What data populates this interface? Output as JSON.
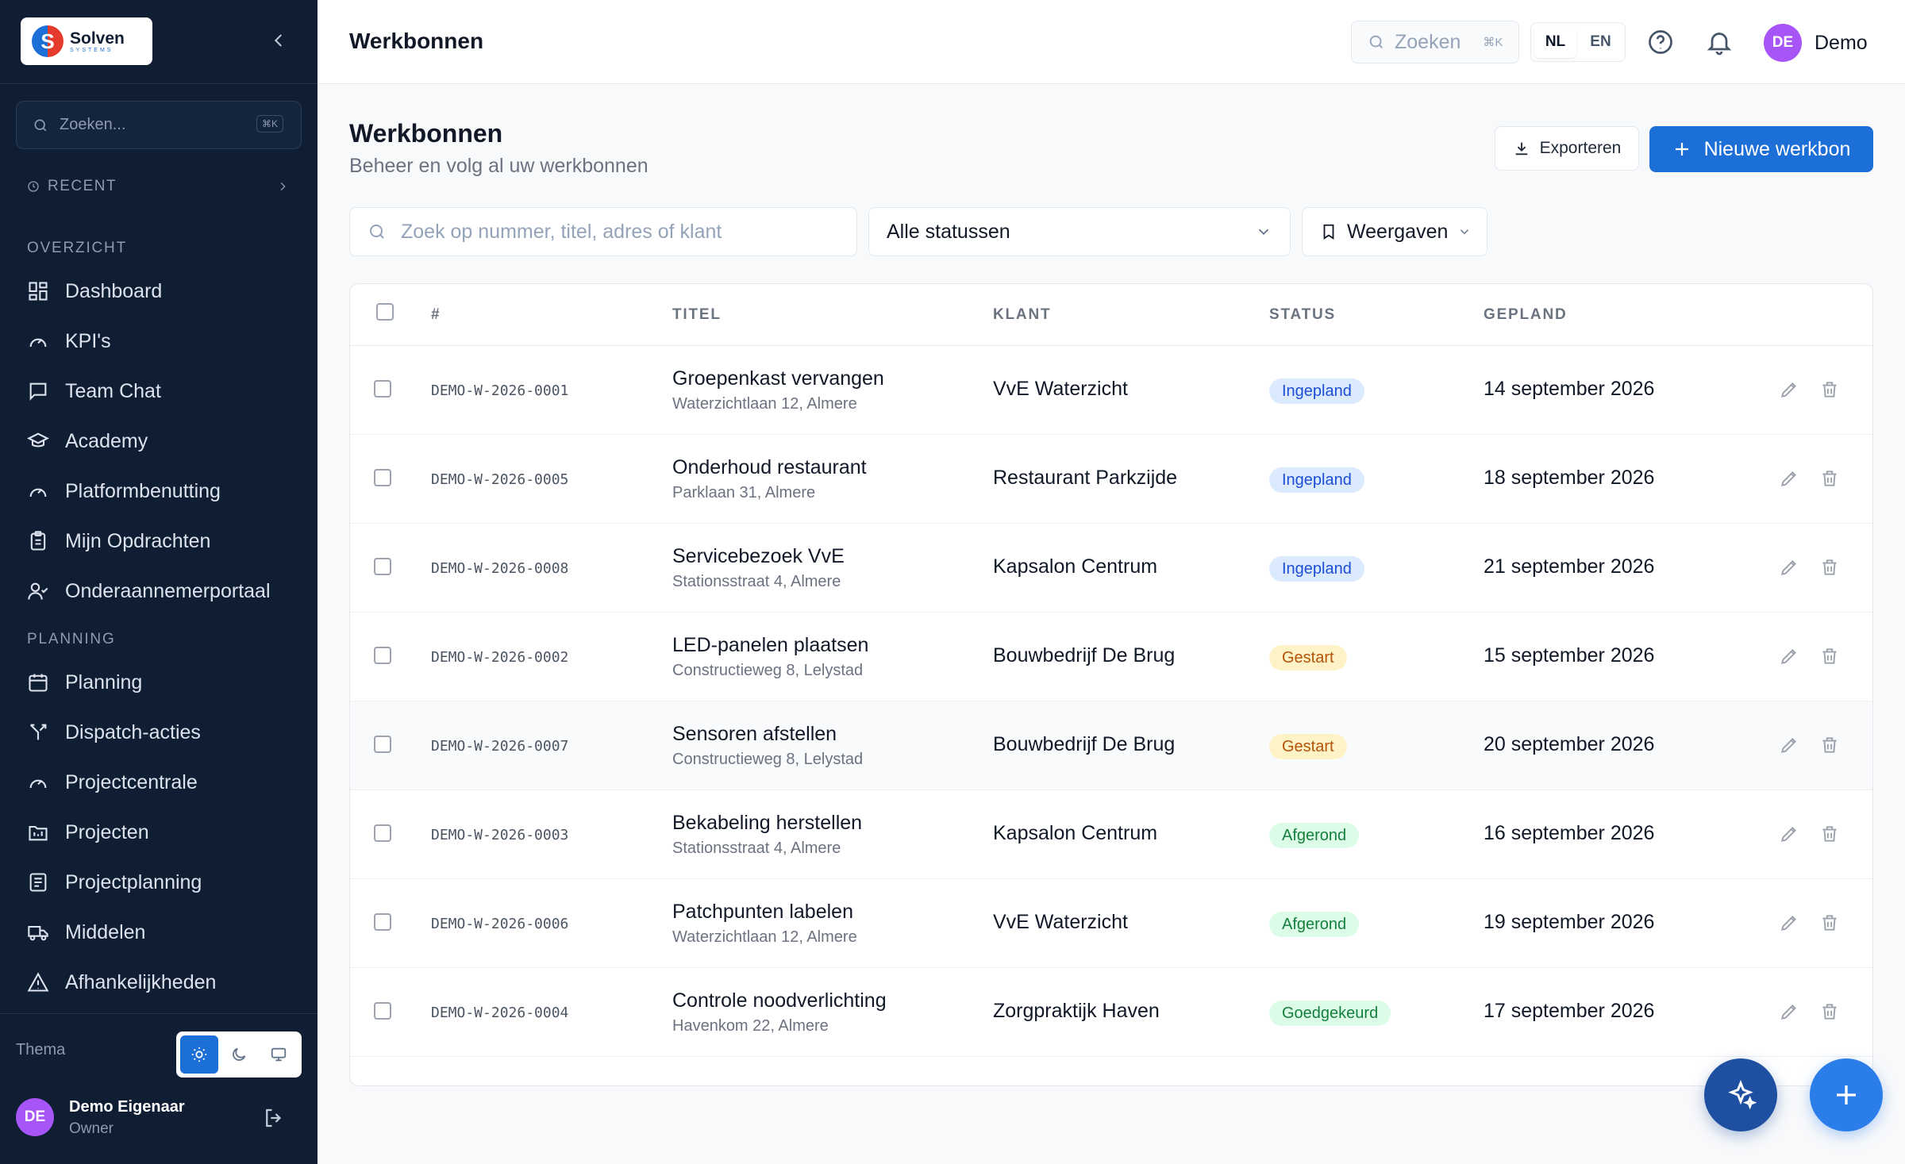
{
  "sidebar": {
    "logo_name": "Solven",
    "logo_sub": "SYSTEMS",
    "search_placeholder": "Zoeken...",
    "search_kbd": "⌘K",
    "recent_label": "RECENT",
    "sections": {
      "overzicht": "OVERZICHT",
      "planning": "PLANNING"
    },
    "items": [
      {
        "label": "Dashboard",
        "icon": "dashboard-icon"
      },
      {
        "label": "KPI's",
        "icon": "gauge-icon"
      },
      {
        "label": "Team Chat",
        "icon": "chat-icon"
      },
      {
        "label": "Academy",
        "icon": "graduation-cap-icon"
      },
      {
        "label": "Platformbenutting",
        "icon": "gauge-icon"
      },
      {
        "label": "Mijn Opdrachten",
        "icon": "clipboard-icon"
      },
      {
        "label": "Onderaannemerportaal",
        "icon": "user-check-icon"
      },
      {
        "label": "Planning",
        "icon": "calendar-icon"
      },
      {
        "label": "Dispatch-acties",
        "icon": "split-icon"
      },
      {
        "label": "Projectcentrale",
        "icon": "gauge-icon"
      },
      {
        "label": "Projecten",
        "icon": "folder-icon"
      },
      {
        "label": "Projectplanning",
        "icon": "list-icon"
      },
      {
        "label": "Middelen",
        "icon": "truck-icon"
      },
      {
        "label": "Afhankelijkheden",
        "icon": "warning-icon"
      }
    ],
    "theme_label": "Thema",
    "user": {
      "initials": "DE",
      "name": "Demo Eigenaar",
      "role": "Owner"
    }
  },
  "topbar": {
    "title": "Werkbonnen",
    "search_placeholder": "Zoeken",
    "search_kbd": "⌘K",
    "lang_nl": "NL",
    "lang_en": "EN",
    "user_initials": "DE",
    "user_name": "Demo"
  },
  "page": {
    "title": "Werkbonnen",
    "subtitle": "Beheer en volg al uw werkbonnen",
    "export_label": "Exporteren",
    "new_label": "Nieuwe werkbon",
    "filter_search_placeholder": "Zoek op nummer, titel, adres of klant",
    "filter_status_value": "Alle statussen",
    "filter_views_label": "Weergaven"
  },
  "table": {
    "headers": {
      "num": "#",
      "title": "TITEL",
      "client": "KLANT",
      "status": "STATUS",
      "planned": "GEPLAND"
    },
    "rows": [
      {
        "num": "DEMO-W-2026-0001",
        "title": "Groepenkast vervangen",
        "address": "Waterzichtlaan 12, Almere",
        "client": "VvE Waterzicht",
        "status": "Ingepland",
        "date": "14 september 2026"
      },
      {
        "num": "DEMO-W-2026-0005",
        "title": "Onderhoud restaurant",
        "address": "Parklaan 31, Almere",
        "client": "Restaurant Parkzijde",
        "status": "Ingepland",
        "date": "18 september 2026"
      },
      {
        "num": "DEMO-W-2026-0008",
        "title": "Servicebezoek VvE",
        "address": "Stationsstraat 4, Almere",
        "client": "Kapsalon Centrum",
        "status": "Ingepland",
        "date": "21 september 2026"
      },
      {
        "num": "DEMO-W-2026-0002",
        "title": "LED-panelen plaatsen",
        "address": "Constructieweg 8, Lelystad",
        "client": "Bouwbedrijf De Brug",
        "status": "Gestart",
        "date": "15 september 2026"
      },
      {
        "num": "DEMO-W-2026-0007",
        "title": "Sensoren afstellen",
        "address": "Constructieweg 8, Lelystad",
        "client": "Bouwbedrijf De Brug",
        "status": "Gestart",
        "date": "20 september 2026"
      },
      {
        "num": "DEMO-W-2026-0003",
        "title": "Bekabeling herstellen",
        "address": "Stationsstraat 4, Almere",
        "client": "Kapsalon Centrum",
        "status": "Afgerond",
        "date": "16 september 2026"
      },
      {
        "num": "DEMO-W-2026-0006",
        "title": "Patchpunten labelen",
        "address": "Waterzichtlaan 12, Almere",
        "client": "VvE Waterzicht",
        "status": "Afgerond",
        "date": "19 september 2026"
      },
      {
        "num": "DEMO-W-2026-0004",
        "title": "Controle noodverlichting",
        "address": "Havenkom 22, Almere",
        "client": "Zorgpraktijk Haven",
        "status": "Goedgekeurd",
        "date": "17 september 2026"
      }
    ]
  },
  "status_colors": {
    "Ingepland": {
      "bg": "#dbeafe",
      "fg": "#1d4ed8"
    },
    "Gestart": {
      "bg": "#fef3c7",
      "fg": "#b45309"
    },
    "Afgerond": {
      "bg": "#dcfce7",
      "fg": "#15803d"
    },
    "Goedgekeurd": {
      "bg": "#dcfce7",
      "fg": "#15803d"
    }
  },
  "colors": {
    "accent": "#1d6fd8",
    "sidebar_bg": "#0f1e33",
    "avatar": "#a855f7"
  }
}
